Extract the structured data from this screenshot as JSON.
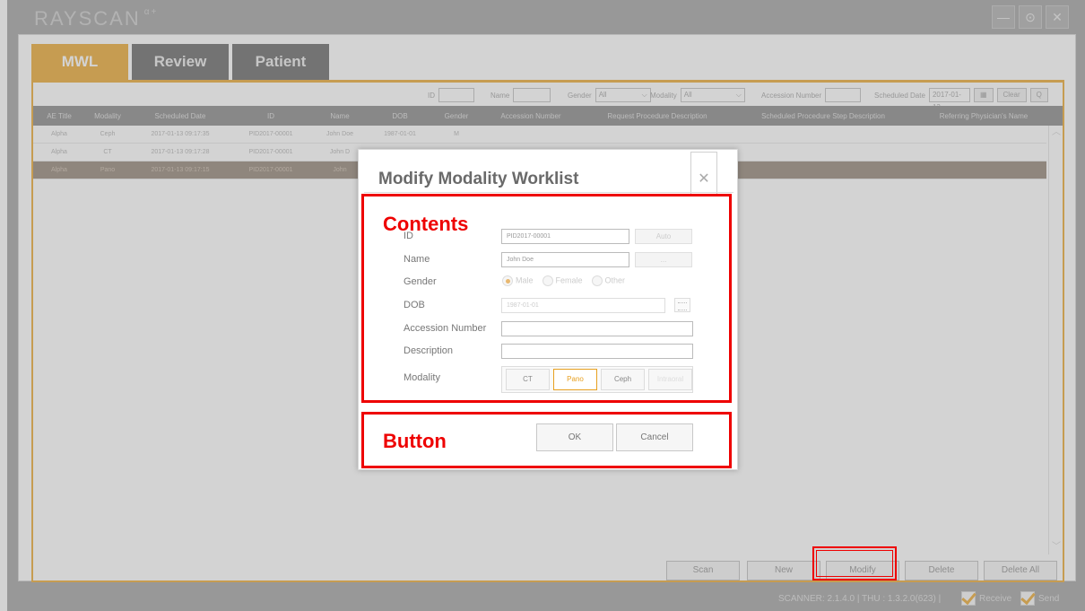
{
  "window": {
    "logo": "RAYSCAN",
    "logo_sup": "α+",
    "controls": {
      "minimize": "—",
      "settings": "⊙",
      "close": "✕"
    }
  },
  "tabs": [
    {
      "label": "MWL",
      "active": true
    },
    {
      "label": "Review",
      "active": false
    },
    {
      "label": "Patient",
      "active": false
    }
  ],
  "filters": {
    "id_label": "ID",
    "name_label": "Name",
    "gender_label": "Gender",
    "gender_value": "All",
    "modality_label": "Modality",
    "modality_value": "All",
    "accession_label": "Accession Number",
    "scheduled_date_label": "Scheduled Date",
    "scheduled_date_value": "2017-01-13",
    "clear_label": "Clear",
    "search_label": "Q"
  },
  "table": {
    "columns": [
      "AE Title",
      "Modality",
      "Scheduled Date",
      "ID",
      "Name",
      "DOB",
      "Gender",
      "Accession Number",
      "Request Procedure Description",
      "Scheduled Procedure Step Description",
      "Referring Physician's Name"
    ],
    "rows": [
      [
        "Alpha",
        "Ceph",
        "2017-01-13 09:17:35",
        "PID2017-00001",
        "John Doe",
        "1987-01-01",
        "M",
        "",
        "",
        "",
        ""
      ],
      [
        "Alpha",
        "CT",
        "2017-01-13 09:17:28",
        "PID2017-00001",
        "John D",
        "",
        "",
        "",
        "",
        "",
        ""
      ],
      [
        "Alpha",
        "Pano",
        "2017-01-13 09:17:15",
        "PID2017-00001",
        "John",
        "",
        "",
        "",
        "",
        "",
        ""
      ]
    ],
    "selected_row": 2
  },
  "bottom_buttons": {
    "scan": "Scan",
    "new": "New",
    "modify": "Modify",
    "delete": "Delete",
    "delete_all": "Delete All"
  },
  "status": {
    "version": "SCANNER: 2.1.4.0 | THU : 1.3.2.0(623) |",
    "receive": "Receive",
    "send": "Send",
    "receive_checked": true,
    "send_checked": true
  },
  "dialog": {
    "title": "Modify Modality Worklist",
    "close": "✕",
    "fields": {
      "id_label": "ID",
      "id_value": "PID2017-00001",
      "auto_button": "Auto",
      "name_label": "Name",
      "name_value": "John Doe",
      "name_button": "...",
      "gender_label": "Gender",
      "gender_options": [
        "Male",
        "Female",
        "Other"
      ],
      "gender_selected": "Male",
      "dob_label": "DOB",
      "dob_value": "1987-01-01",
      "accession_label": "Accession Number",
      "accession_value": "",
      "description_label": "Description",
      "description_value": "",
      "modality_label": "Modality",
      "modality_options": [
        "CT",
        "Pano",
        "Ceph",
        "Intraoral"
      ],
      "modality_selected": "Pano"
    },
    "ok_label": "OK",
    "cancel_label": "Cancel"
  },
  "annotations": {
    "contents": "Contents",
    "button": "Button",
    "color": "#e00000"
  }
}
